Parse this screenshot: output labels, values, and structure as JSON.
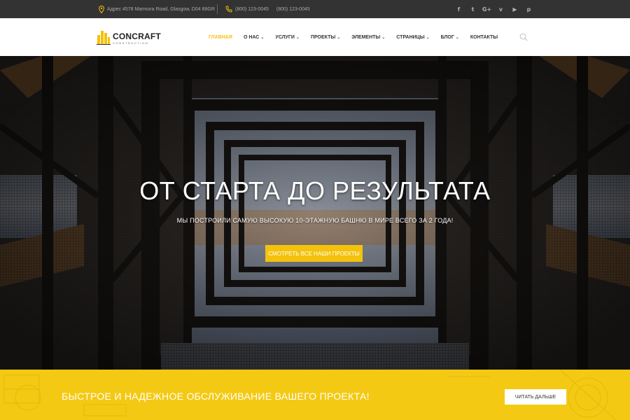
{
  "topbar": {
    "address": "Адрес 4578 Marmora Road, Glasgow, D04 89GR",
    "phone1": "(800) 123-0045",
    "phone2": "(800) 123-0045",
    "social": [
      {
        "icon": "facebook-icon",
        "glyph": "f"
      },
      {
        "icon": "twitter-icon",
        "glyph": "t"
      },
      {
        "icon": "google-plus-icon",
        "glyph": "G+"
      },
      {
        "icon": "vimeo-icon",
        "glyph": "v"
      },
      {
        "icon": "youtube-icon",
        "glyph": "▶"
      },
      {
        "icon": "pinterest-icon",
        "glyph": "p"
      }
    ]
  },
  "logo": {
    "name": "CONCRAFT",
    "sub": "CONSTRUCTION"
  },
  "nav": {
    "items": [
      {
        "label": "ГЛАВНАЯ",
        "active": true,
        "dropdown": false
      },
      {
        "label": "О НАС",
        "active": false,
        "dropdown": true
      },
      {
        "label": "УСЛУГИ",
        "active": false,
        "dropdown": true
      },
      {
        "label": "ПРОЕКТЫ",
        "active": false,
        "dropdown": true
      },
      {
        "label": "ЭЛЕМЕНТЫ",
        "active": false,
        "dropdown": true
      },
      {
        "label": "СТРАНИЦЫ",
        "active": false,
        "dropdown": true
      },
      {
        "label": "БЛОГ",
        "active": false,
        "dropdown": true
      },
      {
        "label": "КОНТАКТЫ",
        "active": false,
        "dropdown": false
      }
    ]
  },
  "hero": {
    "title": "ОТ СТАРТА ДО РЕЗУЛЬТАТА",
    "subtitle": "МЫ ПОСТРОИЛИ САМУЮ ВЫСОКУЮ 10-ЭТАЖНУЮ БАШНЮ В МИРЕ ВСЕГО ЗА 2 ГОДА!",
    "button": "СМОТРЕТЬ ВСЕ НАШИ ПРОЕКТЫ"
  },
  "cta": {
    "text": "БЫСТРОЕ И НАДЕЖНОЕ ОБСЛУЖИВАНИЕ ВАШЕГО ПРОЕКТА!",
    "button": "ЧИТАТЬ ДАЛЬШЕ"
  },
  "colors": {
    "accent": "#f4c20d",
    "topbar": "#333333",
    "cta_band": "#f4c913"
  }
}
